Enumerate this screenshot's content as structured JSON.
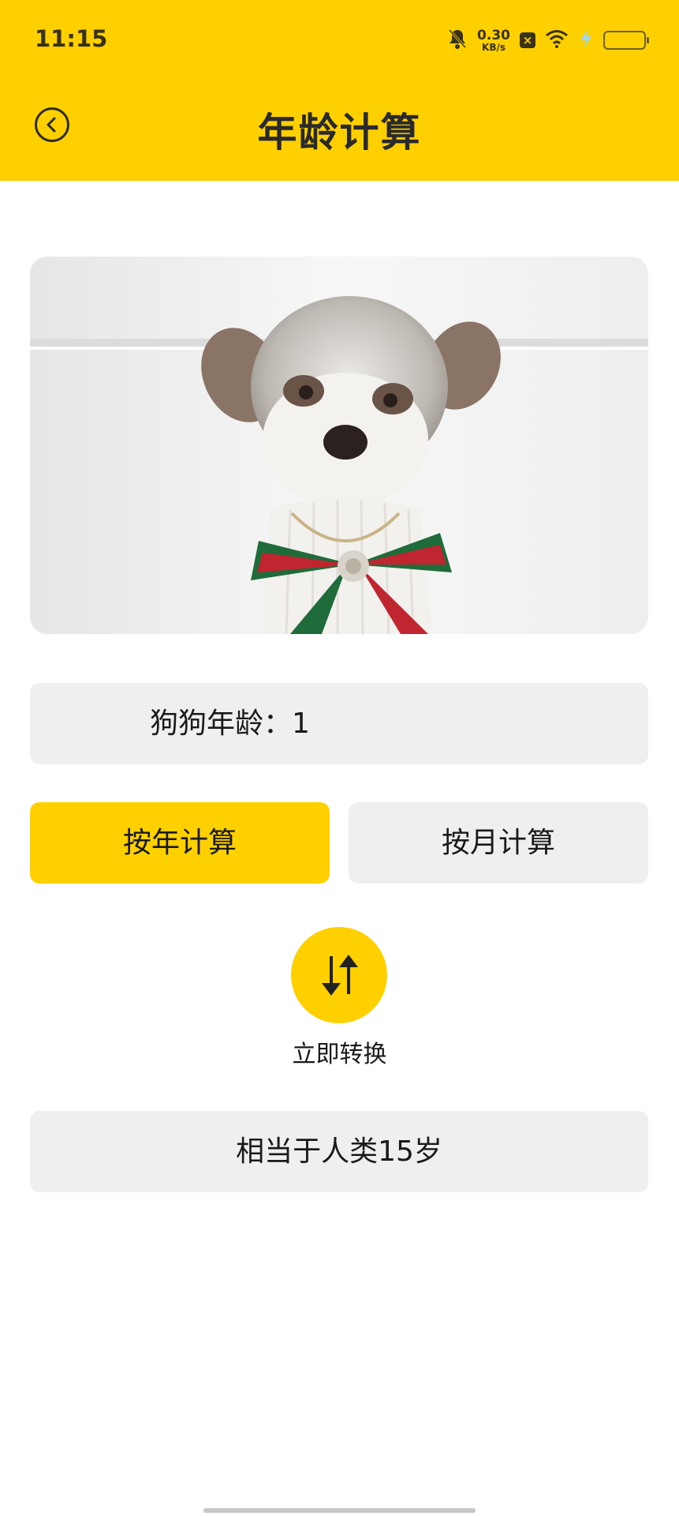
{
  "status_bar": {
    "time": "11:15",
    "net_speed_value": "0.30",
    "net_speed_unit": "KB/s",
    "icons": [
      "bell-muted-icon",
      "close-badge-icon",
      "wifi-icon",
      "charging-icon",
      "battery-icon"
    ]
  },
  "header": {
    "title": "年龄计算",
    "back_icon": "chevron-left-icon",
    "background_color": "#FFD000"
  },
  "dog_age": {
    "label": "狗狗年龄：",
    "value": "1"
  },
  "modes": {
    "year_label": "按年计算",
    "month_label": "按月计算",
    "selected": "按年计算"
  },
  "convert": {
    "icon": "swap-arrows-icon",
    "label": "立即转换"
  },
  "result": {
    "text": "相当于人类15岁"
  },
  "colors": {
    "accent": "#FFD000",
    "panel": "#EFEFEF"
  }
}
